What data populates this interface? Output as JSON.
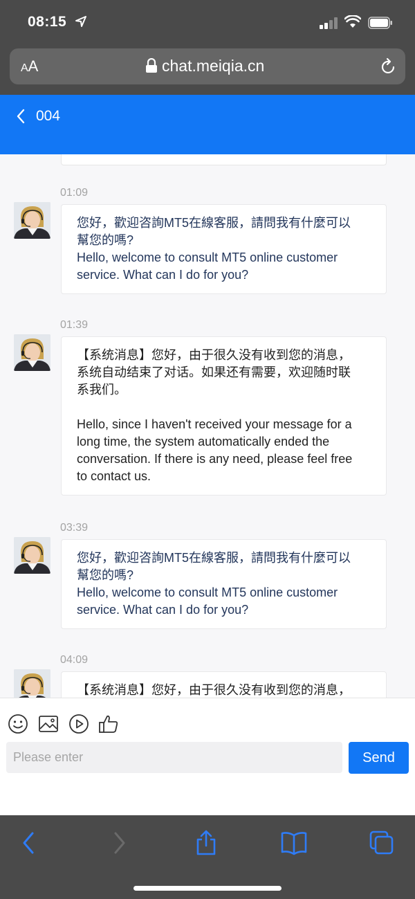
{
  "status_bar": {
    "time": "08:15"
  },
  "browser": {
    "text_size_label_small": "A",
    "text_size_label_large": "A",
    "domain": "chat.meiqia.cn"
  },
  "header": {
    "title": "004"
  },
  "messages": [
    {
      "time": "01:09",
      "lines": [
        "您好，歡迎咨詢MT5在線客服，請問我有什麼可以",
        "幫您的嗎?",
        "Hello, welcome to consult MT5 online customer",
        "service. What can I do for you?"
      ]
    },
    {
      "time": "01:39",
      "lines": [
        "【系统消息】您好，由于很久没有收到您的消息，",
        "系统自动结束了对话。如果还有需要，欢迎随时联",
        "系我们。"
      ],
      "lines_en": [
        "Hello, since I haven't received your message for a",
        "long time, the system automatically ended the",
        "conversation. If there is any need, please feel free",
        "to contact us."
      ]
    },
    {
      "time": "03:39",
      "lines": [
        "您好，歡迎咨詢MT5在線客服，請問我有什麼可以",
        "幫您的嗎?",
        "Hello, welcome to consult MT5 online customer",
        "service. What can I do for you?"
      ]
    },
    {
      "time": "04:09",
      "lines": [
        "【系统消息】您好，由于很久没有收到您的消息，"
      ]
    }
  ],
  "composer": {
    "placeholder": "Please enter",
    "send_label": "Send",
    "tools": [
      "emoji-icon",
      "image-icon",
      "video-icon",
      "thumbs-up-icon"
    ]
  },
  "safari_toolbar": [
    "back-icon",
    "forward-icon",
    "share-icon",
    "bookmarks-icon",
    "tabs-icon"
  ],
  "colors": {
    "accent": "#1277f5",
    "chrome": "#4a4a4a",
    "message_text": "#23365b"
  }
}
